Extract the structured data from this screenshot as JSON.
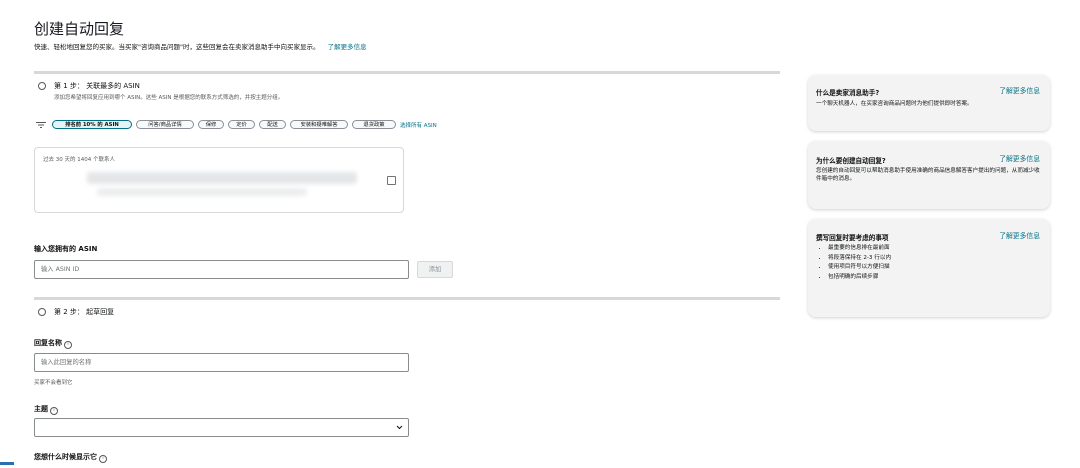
{
  "header": {
    "title": "创建自动回复",
    "subtitle": "快速、轻松地回复您的买家。当买家\"咨询商品问题\"时，这些回复会在卖家消息助手中向买家显示。",
    "learn_more": "了解更多信息"
  },
  "step1": {
    "title": "第 1 步： 关联最多的 ASIN",
    "desc": "添加您希望将回复应用到哪个 ASIN。这些 ASIN 是根据您的联系方式筛选的，并按主题分组。",
    "filter_icon": "filter-icon",
    "chips": [
      "排名前 10% 的 ASIN",
      "问答/商品详情",
      "保修",
      "定价",
      "配送",
      "安装和疑难解答",
      "退货政策"
    ],
    "select_all": "选择所有 ASIN",
    "contacts_caption": "过去 30 天的 1404 个联系人"
  },
  "asin_input": {
    "label": "输入您拥有的 ASIN",
    "placeholder": "输入 ASIN ID",
    "add_button": "添加"
  },
  "step2": {
    "title": "第 2 步： 起草回复"
  },
  "reply_name": {
    "label": "回复名称",
    "placeholder": "输入此回复的名称",
    "hint": "买家不会看到它"
  },
  "topic": {
    "label": "主题",
    "value": ""
  },
  "when_show": {
    "label": "您想什么时候显示它"
  },
  "sidebar": {
    "cards": [
      {
        "title": "什么是卖家消息助手?",
        "link": "了解更多信息",
        "body": "一个聊天机器人，在买家咨询商品问题时为他们提供即时答案。"
      },
      {
        "title": "为什么要创建自动回复?",
        "link": "了解更多信息",
        "body": "您创建的自动回复可以帮助消息助手使用准确的商品信息解答客户提出的问题，从而减少收件箱中的消息。"
      },
      {
        "title": "撰写回复时要考虑的事项",
        "link": "了解更多信息",
        "bullets": [
          "最重要的信息排在最前面",
          "将段落保持在 2-3 行以内",
          "使用项目符号以方便扫描",
          "包括明确的后续步骤"
        ]
      }
    ]
  },
  "colors": {
    "link": "#007185",
    "divider": "#d5d9d9",
    "card_bg": "#f3f3f3"
  }
}
